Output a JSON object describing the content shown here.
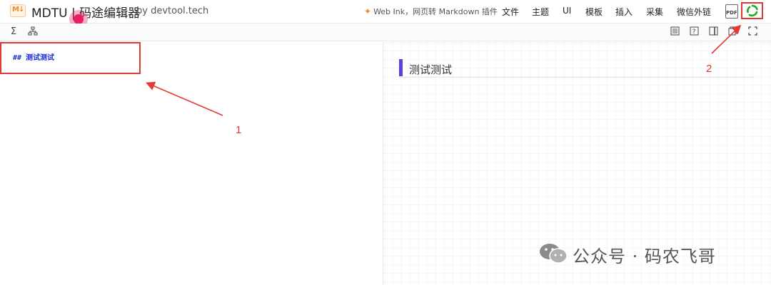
{
  "header": {
    "logo_text": "M↓",
    "app_title": "MDTU | 码途编辑器",
    "app_by": "by devtool.tech",
    "webink_label": "Web Ink，网页转 Markdown 插件",
    "menu": [
      "文件",
      "主题",
      "UI",
      "模板",
      "插入",
      "采集",
      "微信外链"
    ],
    "pdf_label": "PDF"
  },
  "toolbar": {
    "left_icons": [
      "sigma-icon",
      "sitemap-icon"
    ],
    "right_icons": [
      "document-icon",
      "help-icon",
      "split-view-icon",
      "copy-icon",
      "fullscreen-icon"
    ]
  },
  "editor": {
    "line": "## 测试测试"
  },
  "preview": {
    "heading": "测试测试"
  },
  "annotations": {
    "label_1": "1",
    "label_2": "2",
    "color": "#e53935"
  },
  "watermark": {
    "text": "公众号 · 码农飞哥"
  },
  "colors": {
    "accent": "#5b3fe0",
    "logo": "#f08a24",
    "share": "#1aad19"
  }
}
